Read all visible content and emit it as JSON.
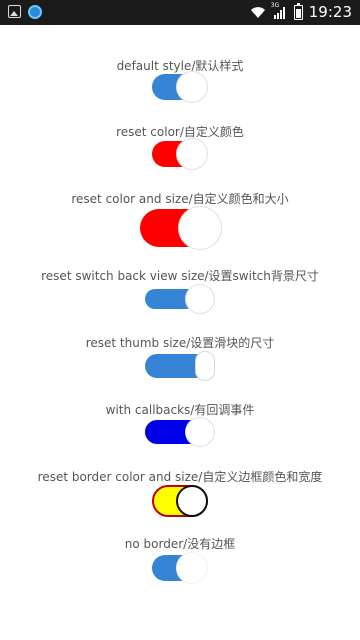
{
  "status_bar": {
    "time": "19:23",
    "network": "3G",
    "icons": [
      "image-icon",
      "app-icon",
      "wifi-icon",
      "signal-icon",
      "battery-icon"
    ]
  },
  "colors": {
    "blue": "#3584d6",
    "red": "#ff0000",
    "pure_blue": "#0000e8",
    "yellow": "#ffff00",
    "border_red": "#c00000"
  },
  "switches": [
    {
      "label": "default style/默认样式",
      "checked": true
    },
    {
      "label": "reset color/自定义颜色",
      "checked": true
    },
    {
      "label": "reset color and size/自定义颜色和大小",
      "checked": true
    },
    {
      "label": "reset switch back view size/设置switch背景尺寸",
      "checked": true
    },
    {
      "label": "reset thumb size/设置滑块的尺寸",
      "checked": true
    },
    {
      "label": "with callbacks/有回调事件",
      "checked": true
    },
    {
      "label": "reset border color and size/自定义边框颜色和宽度",
      "checked": true
    },
    {
      "label": "no border/没有边框",
      "checked": true
    }
  ]
}
